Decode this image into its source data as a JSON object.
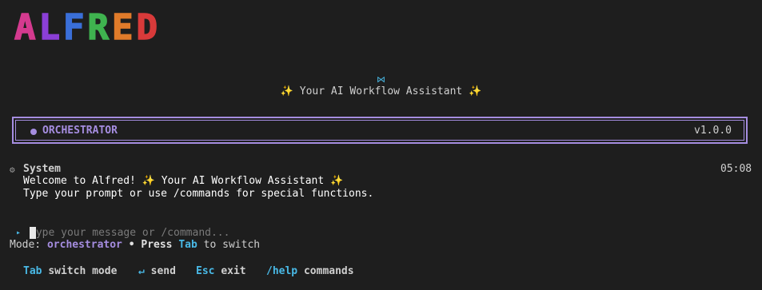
{
  "logo": {
    "letters": [
      {
        "char": "A",
        "color": "#d43a8f"
      },
      {
        "char": "L",
        "color": "#8b3fd6"
      },
      {
        "char": "F",
        "color": "#3a6fd8"
      },
      {
        "char": "R",
        "color": "#3fb34f"
      },
      {
        "char": "E",
        "color": "#e07b2a"
      },
      {
        "char": "D",
        "color": "#d83a3a"
      }
    ]
  },
  "header": {
    "bow_icon": "⋈",
    "tagline_sparkle": "✨",
    "tagline": "Your AI Workflow Assistant"
  },
  "mode_box": {
    "name": "ORCHESTRATOR",
    "version": "v1.0.0",
    "accent": "#a58de0"
  },
  "message": {
    "icon": "⚙",
    "sender": "System",
    "time": "05:08",
    "line1": "Welcome to Alfred! ✨ Your AI Workflow Assistant ✨",
    "line2": "Type your prompt or use /commands for special functions."
  },
  "input": {
    "arrow": "▸",
    "value": "",
    "placeholder": "Type your message or /command..."
  },
  "mode_line": {
    "prefix": "Mode: ",
    "mode": "orchestrator",
    "sep": " • ",
    "press": "Press ",
    "key": "Tab",
    "suffix": " to switch"
  },
  "hints": [
    {
      "key": "Tab",
      "label": "switch mode"
    },
    {
      "key": "↵",
      "label": "send"
    },
    {
      "key": "Esc",
      "label": "exit"
    },
    {
      "key": "/help",
      "label": "commands"
    }
  ]
}
